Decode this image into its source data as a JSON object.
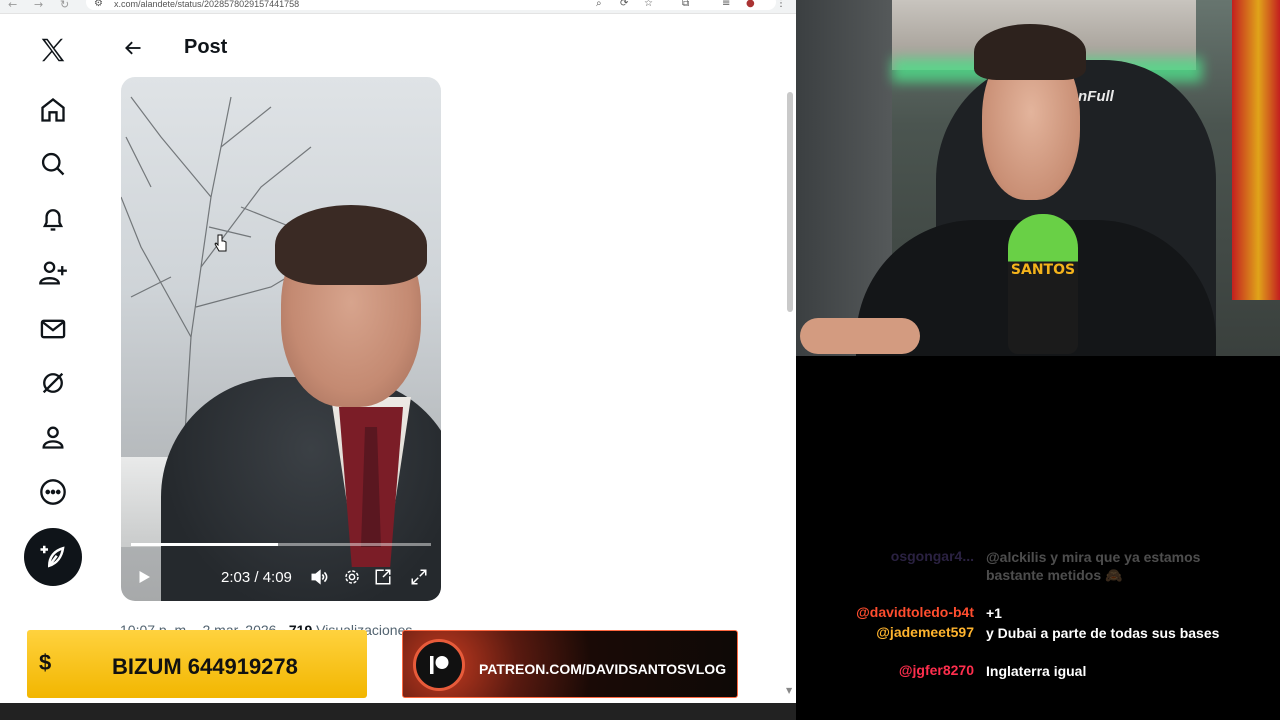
{
  "browser": {
    "url": "x.com/alandete/status/2028578029157441758"
  },
  "sidebar": {
    "items": [
      {
        "name": "x-logo-icon"
      },
      {
        "name": "home-icon"
      },
      {
        "name": "search-icon"
      },
      {
        "name": "notifications-icon"
      },
      {
        "name": "follow-icon"
      },
      {
        "name": "messages-icon"
      },
      {
        "name": "grok-icon"
      },
      {
        "name": "profile-icon"
      },
      {
        "name": "more-icon"
      }
    ],
    "post_button_icon": "feather-plus-icon"
  },
  "header": {
    "title": "Post"
  },
  "video": {
    "timecode": "2:03 / 4:09",
    "progress": 0.49
  },
  "post_meta": {
    "time": "10:07 p. m.",
    "separator": "·",
    "date": "2 mar. 2026",
    "views_count": "719",
    "views_label": "Visualizaciones"
  },
  "banners": {
    "bizum_symbol": "$",
    "bizum_text": "BIZUM 644919278",
    "patreon_text": "PATREON.COM/DAVIDSANTOSVLOG"
  },
  "webcam": {
    "mic_label": "SANTOS",
    "chair_brand": "nFull"
  },
  "chat": {
    "messages": [
      {
        "user": "osgongar4...",
        "text": "@alckilis y mira que ya estamos bastante metidos 🙈",
        "user_color": "#8a6fd6",
        "faded": true
      },
      {
        "user": "@davidtoledo-b4t",
        "text": "+1",
        "user_color": "#ff4d2e",
        "faded": false
      },
      {
        "user": "@jademeet597",
        "text": "y Dubai a parte de todas sus bases",
        "user_color": "#ffb42e",
        "faded": false
      },
      {
        "user": "@jgfer8270",
        "text": "Inglaterra igual",
        "user_color": "#ff2e4d",
        "faded": false
      }
    ]
  },
  "colors": {
    "x_text": "#0f1419",
    "x_secondary": "#536471",
    "bizum_yellow": "#ffd23e",
    "patreon_orange": "#e85b3a"
  }
}
